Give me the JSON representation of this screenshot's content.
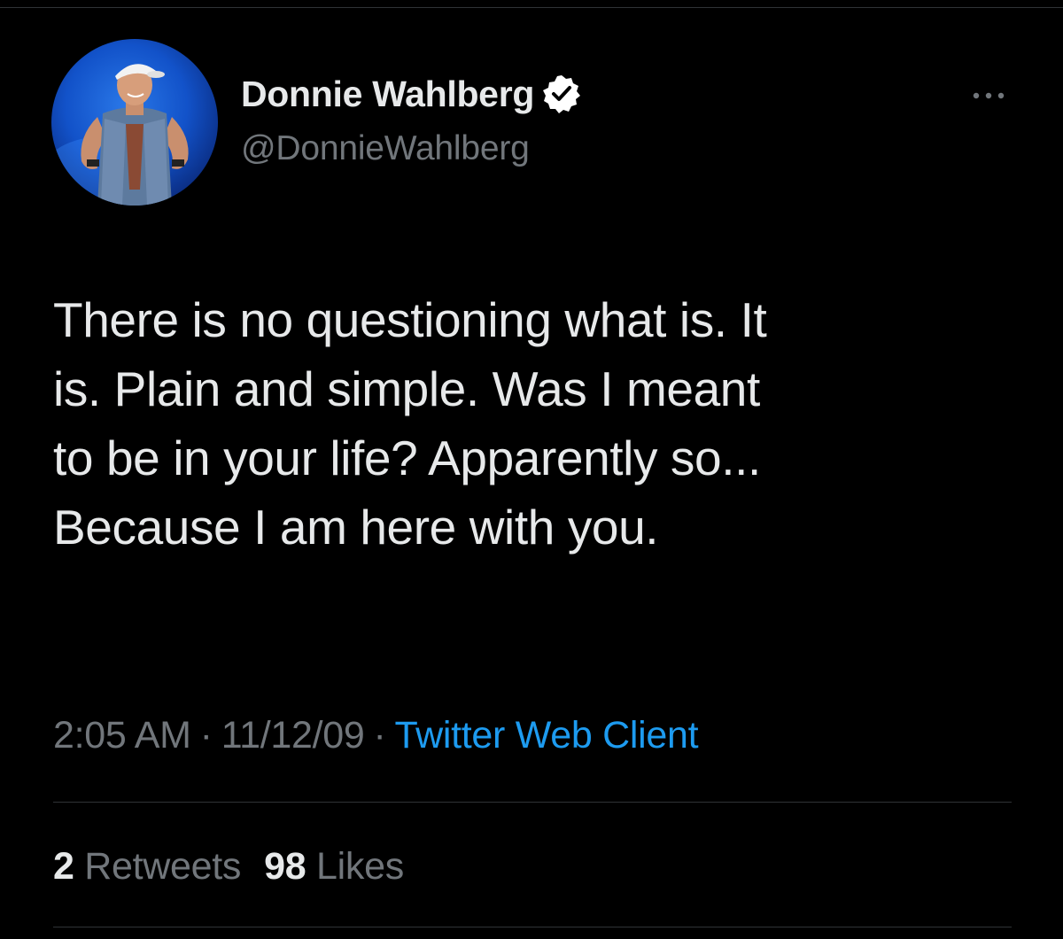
{
  "profile": {
    "display_name": "Donnie Wahlberg",
    "handle": "@DonnieWahlberg",
    "verified": true,
    "avatar_description_icon": "profile-photo"
  },
  "tweet": {
    "lines": [
      "There is no questioning what is.  It",
      "is.  Plain and simple.  Was I meant",
      "to be in your life?  Apparently so...",
      "Because I am here with you."
    ]
  },
  "meta": {
    "time": "2:05 AM",
    "separator": "·",
    "date": "11/12/09",
    "client": "Twitter Web Client"
  },
  "stats": {
    "retweets_count": "2",
    "retweets_label": "Retweets",
    "likes_count": "98",
    "likes_label": "Likes"
  },
  "colors": {
    "background": "#000000",
    "text": "#e7e9ea",
    "secondary": "#71767b",
    "link": "#1d9bf0",
    "divider": "#2f3336"
  }
}
